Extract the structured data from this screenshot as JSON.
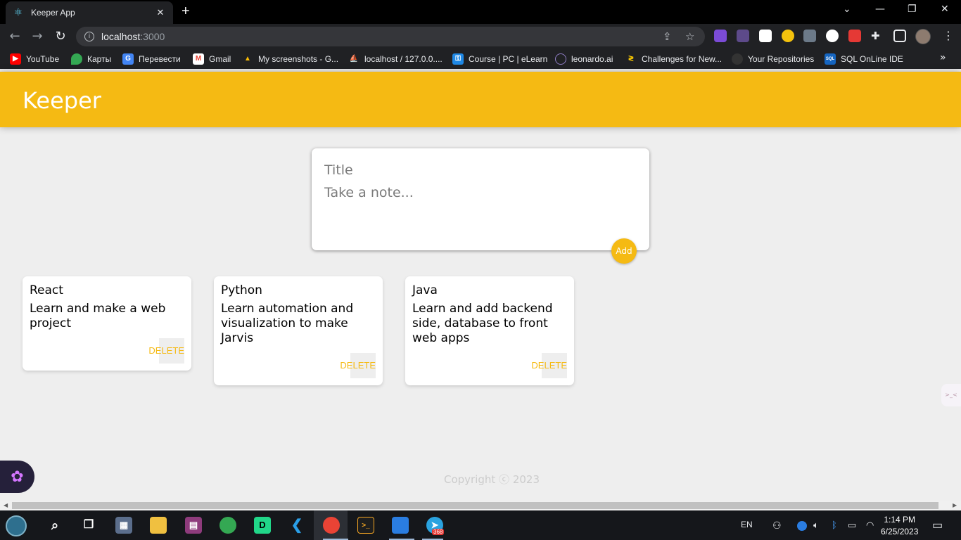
{
  "browser": {
    "tab_title": "Keeper App",
    "url_host": "localhost",
    "url_port": ":3000",
    "bookmarks": [
      {
        "label": "YouTube",
        "icon": "youtube-icon",
        "color": "#ff0000"
      },
      {
        "label": "Карты",
        "icon": "maps-icon",
        "color": "#34a853"
      },
      {
        "label": "Перевести",
        "icon": "translate-icon",
        "color": "#4285f4"
      },
      {
        "label": "Gmail",
        "icon": "gmail-icon",
        "color": "#ea4335"
      },
      {
        "label": "My screenshots - G...",
        "icon": "drive-icon",
        "color": "#fbbc04"
      },
      {
        "label": "localhost / 127.0.0....",
        "icon": "phpmyadmin-icon",
        "color": "#f29111"
      },
      {
        "label": "Course | PC | eLearn",
        "icon": "key-icon",
        "color": "#1e88e5"
      },
      {
        "label": "leonardo.ai",
        "icon": "leonardo-icon",
        "color": "#8e7cc3"
      },
      {
        "label": "Challenges for New...",
        "icon": "challenge-icon",
        "color": "#ffcc00"
      },
      {
        "label": "Your Repositories",
        "icon": "github-icon",
        "color": "#333333"
      },
      {
        "label": "SQL OnLine IDE",
        "icon": "sql-icon",
        "color": "#1565c0"
      }
    ]
  },
  "app": {
    "brand": "Keeper",
    "accent": "#f5ba13",
    "create": {
      "title_placeholder": "Title",
      "body_placeholder": "Take a note...",
      "add_label": "Add"
    },
    "notes": [
      {
        "title": "React",
        "content": "Learn and make a web\nproject",
        "delete_label": "DELETE"
      },
      {
        "title": "Python",
        "content": "Learn automation and\nvisualization to make\nJarvis",
        "delete_label": "DELETE"
      },
      {
        "title": "Java",
        "content": "Learn and add backend\nside, database to front\nweb apps",
        "delete_label": "DELETE"
      }
    ],
    "footer": "Copyright ⓒ 2023"
  },
  "taskbar": {
    "language": "EN",
    "time": "1:14 PM",
    "date": "6/25/2023",
    "telegram_badge": "368"
  }
}
